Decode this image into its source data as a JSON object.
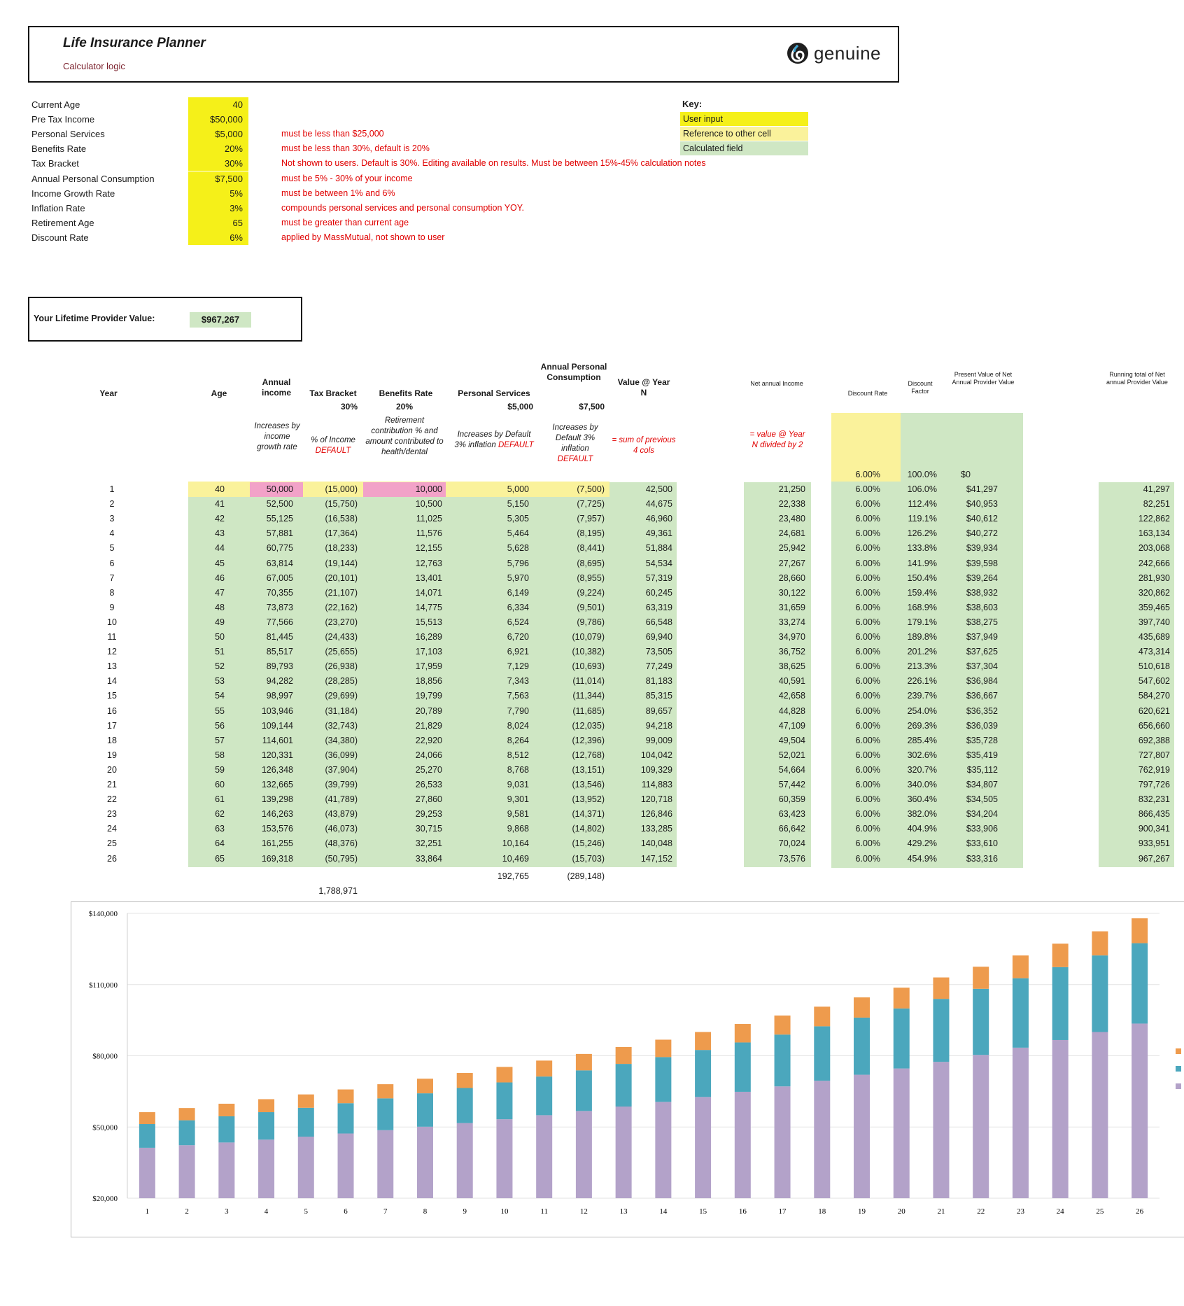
{
  "header": {
    "title": "Life Insurance Planner",
    "subtitle": "Calculator logic",
    "logo_text": "genuine"
  },
  "inputs": [
    {
      "label": "Current Age",
      "value": "40",
      "note": ""
    },
    {
      "label": "Pre Tax Income",
      "value": "$50,000",
      "note": ""
    },
    {
      "label": "Personal Services",
      "value": "$5,000",
      "note": "must be less than $25,000"
    },
    {
      "label": "Benefits Rate",
      "value": "20%",
      "note": "must be less than 30%, default is 20%"
    },
    {
      "label": "Tax Bracket",
      "value": "30%",
      "note": "Not shown to users. Default is 30%. Editing available on results. Must be between 15%-45% calculation notes"
    },
    {
      "label": "Annual Personal Consumption",
      "value": "$7,500",
      "note": "must be 5% - 30% of your income"
    },
    {
      "label": "Income Growth Rate",
      "value": "5%",
      "note": "must be between 1% and 6%"
    },
    {
      "label": "Inflation Rate",
      "value": "3%",
      "note": "compounds personal services and personal consumption YOY."
    },
    {
      "label": "Retirement Age",
      "value": "65",
      "note": "must be greater than current age"
    },
    {
      "label": "Discount Rate",
      "value": "6%",
      "note": "applied by MassMutual, not shown to user"
    }
  ],
  "key": {
    "title": "Key:",
    "items": [
      {
        "label": "User input",
        "color": "#f5f019"
      },
      {
        "label": "Reference to other cell",
        "color": "#faf29b"
      },
      {
        "label": "Calculated field",
        "color": "#cfe7c4"
      }
    ]
  },
  "lifetime": {
    "label": "Your Lifetime Provider Value:",
    "value": "$967,267"
  },
  "table": {
    "headers": {
      "year": "Year",
      "age": "Age",
      "income": "Annual income",
      "tax": "Tax Bracket",
      "benefits": "Benefits Rate",
      "services": "Personal Services",
      "consumption": "Annual Personal Consumption",
      "value": "Value @ Year N",
      "net_income": "Net annual Income",
      "discount_rate": "Discount Rate",
      "discount_factor": "Discount Factor",
      "pv": "Present Value of Net Annual Provider Value",
      "running": "Running total of Net annual Provider Value"
    },
    "subheaders": {
      "tax": "30%",
      "benefits": "20%",
      "services": "$5,000",
      "consumption": "$7,500"
    },
    "notes": {
      "income": "Increases by income growth rate",
      "tax_a": "% of Income",
      "tax_b": "DEFAULT",
      "benefits": "Retirement contribution % and amount contributed to health/dental",
      "services_a": "Increases by Default 3% inflation",
      "services_b": "DEFAULT",
      "consumption_a": "Increases by Default 3% inflation",
      "consumption_b": "DEFAULT",
      "value": "= sum of previous 4 cols",
      "net": "= value @ Year N divided by 2"
    },
    "preface": {
      "discount_rate": "6.00%",
      "discount_factor": "100.0%",
      "pv": "$0"
    },
    "rows": [
      [
        "1",
        "40",
        "50,000",
        "(15,000)",
        "10,000",
        "5,000",
        "(7,500)",
        "42,500",
        "21,250",
        "6.00%",
        "106.0%",
        "$41,297",
        "41,297"
      ],
      [
        "2",
        "41",
        "52,500",
        "(15,750)",
        "10,500",
        "5,150",
        "(7,725)",
        "44,675",
        "22,338",
        "6.00%",
        "112.4%",
        "$40,953",
        "82,251"
      ],
      [
        "3",
        "42",
        "55,125",
        "(16,538)",
        "11,025",
        "5,305",
        "(7,957)",
        "46,960",
        "23,480",
        "6.00%",
        "119.1%",
        "$40,612",
        "122,862"
      ],
      [
        "4",
        "43",
        "57,881",
        "(17,364)",
        "11,576",
        "5,464",
        "(8,195)",
        "49,361",
        "24,681",
        "6.00%",
        "126.2%",
        "$40,272",
        "163,134"
      ],
      [
        "5",
        "44",
        "60,775",
        "(18,233)",
        "12,155",
        "5,628",
        "(8,441)",
        "51,884",
        "25,942",
        "6.00%",
        "133.8%",
        "$39,934",
        "203,068"
      ],
      [
        "6",
        "45",
        "63,814",
        "(19,144)",
        "12,763",
        "5,796",
        "(8,695)",
        "54,534",
        "27,267",
        "6.00%",
        "141.9%",
        "$39,598",
        "242,666"
      ],
      [
        "7",
        "46",
        "67,005",
        "(20,101)",
        "13,401",
        "5,970",
        "(8,955)",
        "57,319",
        "28,660",
        "6.00%",
        "150.4%",
        "$39,264",
        "281,930"
      ],
      [
        "8",
        "47",
        "70,355",
        "(21,107)",
        "14,071",
        "6,149",
        "(9,224)",
        "60,245",
        "30,122",
        "6.00%",
        "159.4%",
        "$38,932",
        "320,862"
      ],
      [
        "9",
        "48",
        "73,873",
        "(22,162)",
        "14,775",
        "6,334",
        "(9,501)",
        "63,319",
        "31,659",
        "6.00%",
        "168.9%",
        "$38,603",
        "359,465"
      ],
      [
        "10",
        "49",
        "77,566",
        "(23,270)",
        "15,513",
        "6,524",
        "(9,786)",
        "66,548",
        "33,274",
        "6.00%",
        "179.1%",
        "$38,275",
        "397,740"
      ],
      [
        "11",
        "50",
        "81,445",
        "(24,433)",
        "16,289",
        "6,720",
        "(10,079)",
        "69,940",
        "34,970",
        "6.00%",
        "189.8%",
        "$37,949",
        "435,689"
      ],
      [
        "12",
        "51",
        "85,517",
        "(25,655)",
        "17,103",
        "6,921",
        "(10,382)",
        "73,505",
        "36,752",
        "6.00%",
        "201.2%",
        "$37,625",
        "473,314"
      ],
      [
        "13",
        "52",
        "89,793",
        "(26,938)",
        "17,959",
        "7,129",
        "(10,693)",
        "77,249",
        "38,625",
        "6.00%",
        "213.3%",
        "$37,304",
        "510,618"
      ],
      [
        "14",
        "53",
        "94,282",
        "(28,285)",
        "18,856",
        "7,343",
        "(11,014)",
        "81,183",
        "40,591",
        "6.00%",
        "226.1%",
        "$36,984",
        "547,602"
      ],
      [
        "15",
        "54",
        "98,997",
        "(29,699)",
        "19,799",
        "7,563",
        "(11,344)",
        "85,315",
        "42,658",
        "6.00%",
        "239.7%",
        "$36,667",
        "584,270"
      ],
      [
        "16",
        "55",
        "103,946",
        "(31,184)",
        "20,789",
        "7,790",
        "(11,685)",
        "89,657",
        "44,828",
        "6.00%",
        "254.0%",
        "$36,352",
        "620,621"
      ],
      [
        "17",
        "56",
        "109,144",
        "(32,743)",
        "21,829",
        "8,024",
        "(12,035)",
        "94,218",
        "47,109",
        "6.00%",
        "269.3%",
        "$36,039",
        "656,660"
      ],
      [
        "18",
        "57",
        "114,601",
        "(34,380)",
        "22,920",
        "8,264",
        "(12,396)",
        "99,009",
        "49,504",
        "6.00%",
        "285.4%",
        "$35,728",
        "692,388"
      ],
      [
        "19",
        "58",
        "120,331",
        "(36,099)",
        "24,066",
        "8,512",
        "(12,768)",
        "104,042",
        "52,021",
        "6.00%",
        "302.6%",
        "$35,419",
        "727,807"
      ],
      [
        "20",
        "59",
        "126,348",
        "(37,904)",
        "25,270",
        "8,768",
        "(13,151)",
        "109,329",
        "54,664",
        "6.00%",
        "320.7%",
        "$35,112",
        "762,919"
      ],
      [
        "21",
        "60",
        "132,665",
        "(39,799)",
        "26,533",
        "9,031",
        "(13,546)",
        "114,883",
        "57,442",
        "6.00%",
        "340.0%",
        "$34,807",
        "797,726"
      ],
      [
        "22",
        "61",
        "139,298",
        "(41,789)",
        "27,860",
        "9,301",
        "(13,952)",
        "120,718",
        "60,359",
        "6.00%",
        "360.4%",
        "$34,505",
        "832,231"
      ],
      [
        "23",
        "62",
        "146,263",
        "(43,879)",
        "29,253",
        "9,581",
        "(14,371)",
        "126,846",
        "63,423",
        "6.00%",
        "382.0%",
        "$34,204",
        "866,435"
      ],
      [
        "24",
        "63",
        "153,576",
        "(46,073)",
        "30,715",
        "9,868",
        "(14,802)",
        "133,285",
        "66,642",
        "6.00%",
        "404.9%",
        "$33,906",
        "900,341"
      ],
      [
        "25",
        "64",
        "161,255",
        "(48,376)",
        "32,251",
        "10,164",
        "(15,246)",
        "140,048",
        "70,024",
        "6.00%",
        "429.2%",
        "$33,610",
        "933,951"
      ],
      [
        "26",
        "65",
        "169,318",
        "(50,795)",
        "33,864",
        "10,469",
        "(15,703)",
        "147,152",
        "73,576",
        "6.00%",
        "454.9%",
        "$33,316",
        "967,267"
      ]
    ],
    "totals": {
      "services": "192,765",
      "consumption": "(289,148)",
      "tax": "1,788,971"
    }
  },
  "chart_data": {
    "type": "bar",
    "stacked": true,
    "categories": [
      "1",
      "2",
      "3",
      "4",
      "5",
      "6",
      "7",
      "8",
      "9",
      "10",
      "11",
      "12",
      "13",
      "14",
      "15",
      "16",
      "17",
      "18",
      "19",
      "20",
      "21",
      "22",
      "23",
      "24",
      "25",
      "26"
    ],
    "yticks": [
      "$140,000",
      "$110,000",
      "$80,000",
      "$50,000",
      "$20,000"
    ],
    "ylim": [
      20000,
      140000
    ],
    "series": [
      {
        "color": "#b3a2c9",
        "values": [
          21250,
          22338,
          23480,
          24681,
          25942,
          27267,
          28660,
          30122,
          31659,
          33274,
          34970,
          36752,
          38625,
          40591,
          42658,
          44828,
          47109,
          49504,
          52021,
          54664,
          57442,
          60359,
          63423,
          66642,
          70024,
          73576
        ]
      },
      {
        "color": "#4ba7bd",
        "values": [
          10000,
          10500,
          11025,
          11576,
          12155,
          12763,
          13401,
          14071,
          14775,
          15513,
          16289,
          17103,
          17959,
          18856,
          19799,
          20789,
          21829,
          22920,
          24066,
          25270,
          26533,
          27860,
          29253,
          30715,
          32251,
          33864
        ]
      },
      {
        "color": "#ee9b4d",
        "values": [
          5000,
          5150,
          5305,
          5464,
          5628,
          5796,
          5970,
          6149,
          6334,
          6524,
          6720,
          6921,
          7129,
          7343,
          7563,
          7790,
          8024,
          8264,
          8512,
          8768,
          9031,
          9301,
          9581,
          9868,
          10164,
          10469
        ]
      }
    ],
    "grid": true
  }
}
